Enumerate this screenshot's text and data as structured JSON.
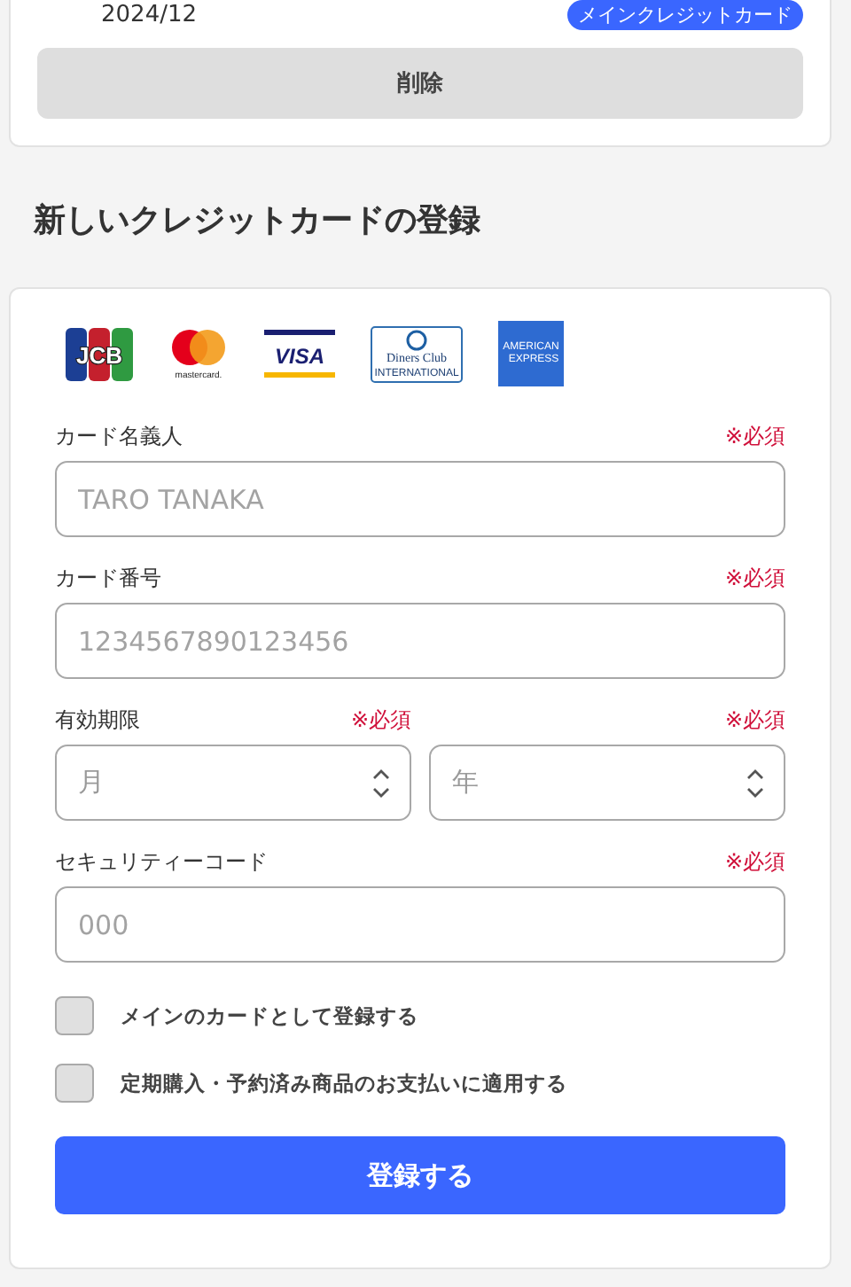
{
  "current_card": {
    "expiry": "2024/12",
    "badge": "メインクレジットカード",
    "delete_button": "削除"
  },
  "section_title": "新しいクレジットカードの登録",
  "card_brands": [
    {
      "kind": "jcb",
      "lines": [
        "JCB"
      ]
    },
    {
      "kind": "mastercard",
      "lines": [
        "mastercard."
      ]
    },
    {
      "kind": "visa",
      "lines": [
        "VISA"
      ]
    },
    {
      "kind": "diners",
      "lines": [
        "Diners Club",
        "INTERNATIONAL"
      ]
    },
    {
      "kind": "amex",
      "lines": [
        "AMERICAN",
        "EXPRESS"
      ]
    }
  ],
  "fields": [
    {
      "kind": "text",
      "label": "カード名義人",
      "required": "※必須",
      "placeholder": "TARO TANAKA"
    },
    {
      "kind": "text",
      "label": "カード番号",
      "required": "※必須",
      "placeholder": "1234567890123456"
    },
    {
      "kind": "selects",
      "label": "有効期限",
      "required_left": "※必須",
      "required": "※必須",
      "selects": [
        "月",
        "年"
      ]
    },
    {
      "kind": "text",
      "label": "セキュリティーコード",
      "required": "※必須",
      "placeholder": "000"
    }
  ],
  "checkboxes": [
    {
      "label": "メインのカードとして登録する",
      "checked": false
    },
    {
      "label": "定期購入・予約済み商品のお支払いに適用する",
      "checked": false
    }
  ],
  "submit_button": "登録する"
}
